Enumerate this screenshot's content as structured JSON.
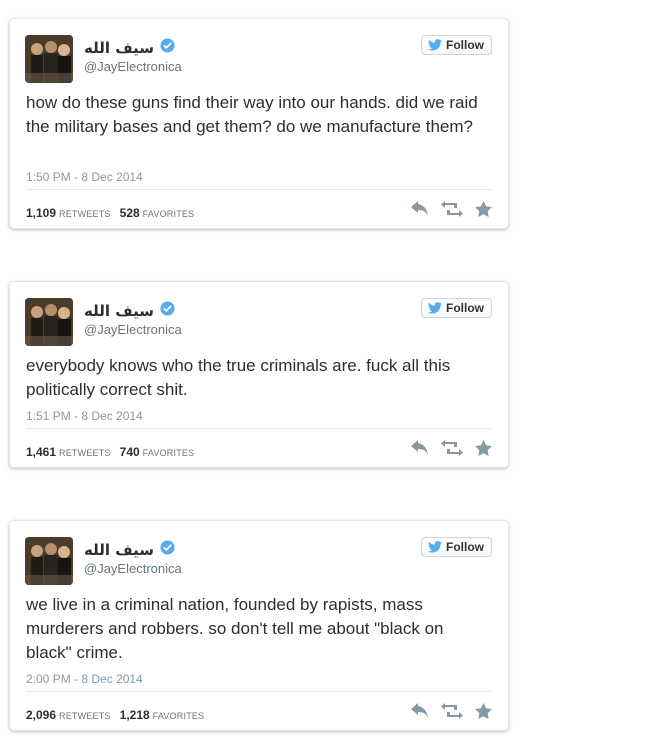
{
  "tweets": [
    {
      "display_name": "سيف الله",
      "handle": "@JayElectronica",
      "follow_label": "Follow",
      "text": "how do these guns find their way into our hands. did we raid the military bases and get them? do we manufacture them?",
      "timestamp": "1:50 PM - 8 Dec 2014",
      "retweets": "1,109",
      "retweets_label": "RETWEETS",
      "favorites": "528",
      "favorites_label": "FAVORITES"
    },
    {
      "display_name": "سيف الله",
      "handle": "@JayElectronica",
      "follow_label": "Follow",
      "text": "everybody knows who the true criminals are. fuck all this politically correct shit.",
      "timestamp": "1:51 PM - 8 Dec 2014",
      "retweets": "1,461",
      "retweets_label": "RETWEETS",
      "favorites": "740",
      "favorites_label": "FAVORITES"
    },
    {
      "display_name": "سيف الله",
      "handle": "@JayElectronica",
      "follow_label": "Follow",
      "text": "we live in a criminal nation, founded by rapists, mass murderers and robbers. so don't tell me about \"black on black\" crime.",
      "timestamp": "2:00 PM - 8 Dec 2014",
      "retweets": "2,096",
      "retweets_label": "RETWEETS",
      "favorites": "1,218",
      "favorites_label": "FAVORITES"
    }
  ],
  "colors": {
    "verified": "#55acee",
    "twitter_bird": "#55acee",
    "action_icon": "#8899a6"
  }
}
